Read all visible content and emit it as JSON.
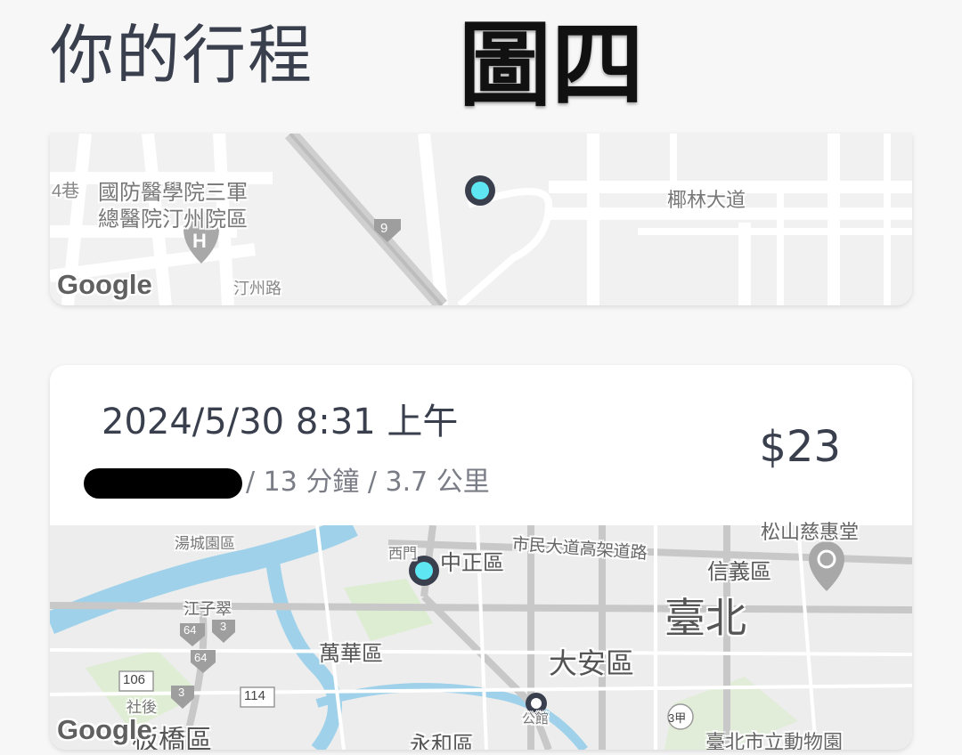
{
  "header": {
    "title": "你的行程",
    "figure_label": "圖四"
  },
  "trip_card_1": {
    "map": {
      "labels": {
        "hospital_line1": "國防醫學院三軍",
        "hospital_line2": "總醫院汀州院區",
        "road_yelin": "椰林大道",
        "lane": "4巷",
        "route_shield": "9",
        "tingzhou": "汀州路",
        "hospital_glyph": "H"
      },
      "attribution": "Google"
    }
  },
  "trip_card_2": {
    "datetime": "2024/5/30  8:31 上午",
    "meta": "/ 13 分鐘 / 3.7 公里",
    "price": "$23",
    "map": {
      "labels": {
        "tangcheng": "湯城園區",
        "ximen": "西門",
        "zhongzheng": "中正區",
        "expressway": "市民大道高架道路",
        "songshan": "松山慈惠堂",
        "xinyi": "信義區",
        "taipei": "臺北",
        "jiangzicui": "江子翠",
        "wanhua": "萬華區",
        "daan": "大安區",
        "shehou": "社後",
        "banqiao": "板橋區",
        "yonghe": "永和區",
        "gongguan": "公館",
        "zoo": "臺北市立動物園",
        "r64a": "64",
        "r3a": "3",
        "r64b": "64",
        "r106": "106",
        "r114": "114",
        "r3b": "3",
        "r3c": "3甲"
      },
      "attribution": "Google"
    }
  },
  "colors": {
    "accent_pin": "#5ee7f2",
    "pin_ring": "#3a3f4d",
    "text_primary": "#3a3f4d",
    "text_secondary": "#7a7d86",
    "river": "#9fd2ea",
    "park": "#d8ecc9"
  }
}
